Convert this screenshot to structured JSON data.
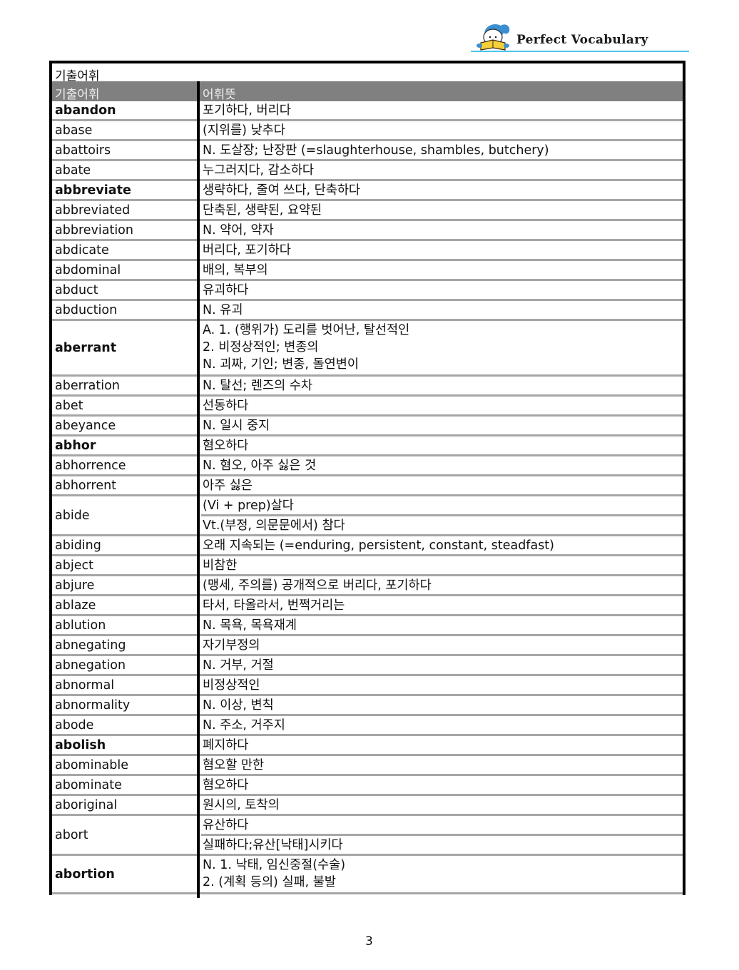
{
  "brand": {
    "name": "Perfect Vocabulary",
    "mascot_icon": "reading-mascot-icon",
    "accent_color": "#4fc3e8"
  },
  "table": {
    "title": "기출어휘",
    "header_color": "#808080",
    "columns": [
      "기출어휘",
      "어휘뜻"
    ],
    "rows": [
      {
        "word": "abandon",
        "bold": true,
        "meanings": [
          [
            "포기하다, 버리다"
          ]
        ]
      },
      {
        "word": "abase",
        "bold": false,
        "meanings": [
          [
            "(지위를)  낮추다"
          ]
        ]
      },
      {
        "word": "abattoirs",
        "bold": false,
        "meanings": [
          [
            "N. 도살장; 난장판  (=slaughterhouse, shambles, butchery)"
          ]
        ]
      },
      {
        "word": "abate",
        "bold": false,
        "meanings": [
          [
            "누그러지다, 감소하다"
          ]
        ]
      },
      {
        "word": "abbreviate",
        "bold": true,
        "meanings": [
          [
            "생략하다, 줄여 쓰다, 단축하다"
          ]
        ]
      },
      {
        "word": "abbreviated",
        "bold": false,
        "meanings": [
          [
            "단축된, 생략된, 요약된"
          ]
        ]
      },
      {
        "word": "abbreviation",
        "bold": false,
        "meanings": [
          [
            "N. 약어, 약자"
          ]
        ]
      },
      {
        "word": "abdicate",
        "bold": false,
        "meanings": [
          [
            "버리다, 포기하다"
          ]
        ]
      },
      {
        "word": "abdominal",
        "bold": false,
        "meanings": [
          [
            "배의, 복부의"
          ]
        ]
      },
      {
        "word": "abduct",
        "bold": false,
        "meanings": [
          [
            "유괴하다"
          ]
        ]
      },
      {
        "word": "abduction",
        "bold": false,
        "meanings": [
          [
            "N. 유괴"
          ]
        ]
      },
      {
        "word": "aberrant",
        "bold": true,
        "meanings": [
          [
            "A. 1. (행위가) 도리를 벗어난, 탈선적인",
            "2. 비정상적인; 변종의",
            "N. 괴짜, 기인; 변종, 돌연변이"
          ]
        ]
      },
      {
        "word": "aberration",
        "bold": false,
        "meanings": [
          [
            "N. 탈선; 렌즈의 수차"
          ]
        ]
      },
      {
        "word": "abet",
        "bold": false,
        "meanings": [
          [
            "선동하다"
          ]
        ]
      },
      {
        "word": "abeyance",
        "bold": false,
        "meanings": [
          [
            "N. 일시 중지"
          ]
        ]
      },
      {
        "word": "abhor",
        "bold": true,
        "meanings": [
          [
            "혐오하다"
          ]
        ]
      },
      {
        "word": "abhorrence",
        "bold": false,
        "meanings": [
          [
            "N. 혐오, 아주 싫은 것"
          ]
        ]
      },
      {
        "word": "abhorrent",
        "bold": false,
        "meanings": [
          [
            "아주 싫은"
          ]
        ]
      },
      {
        "word": "abide",
        "bold": false,
        "meanings": [
          [
            "(Vi + prep)살다"
          ],
          [
            "Vt.(부정, 의문문에서) 참다"
          ]
        ]
      },
      {
        "word": "abiding",
        "bold": false,
        "meanings": [
          [
            "오래 지속되는 (=enduring, persistent, constant, steadfast)"
          ]
        ]
      },
      {
        "word": "abject",
        "bold": false,
        "meanings": [
          [
            "비참한"
          ]
        ]
      },
      {
        "word": "abjure",
        "bold": false,
        "meanings": [
          [
            "(맹세, 주의를) 공개적으로 버리다, 포기하다"
          ]
        ]
      },
      {
        "word": "ablaze",
        "bold": false,
        "meanings": [
          [
            "타서, 타올라서, 번쩍거리는"
          ]
        ]
      },
      {
        "word": "ablution",
        "bold": false,
        "meanings": [
          [
            "N. 목욕, 목욕재계"
          ]
        ]
      },
      {
        "word": "abnegating",
        "bold": false,
        "meanings": [
          [
            "자기부정의"
          ]
        ]
      },
      {
        "word": "abnegation",
        "bold": false,
        "meanings": [
          [
            "N. 거부, 거절"
          ]
        ]
      },
      {
        "word": "abnormal",
        "bold": false,
        "meanings": [
          [
            "비정상적인"
          ]
        ]
      },
      {
        "word": "abnormality",
        "bold": false,
        "meanings": [
          [
            "N. 이상, 변칙"
          ]
        ]
      },
      {
        "word": "abode",
        "bold": false,
        "meanings": [
          [
            "N. 주소, 거주지"
          ]
        ]
      },
      {
        "word": "abolish",
        "bold": true,
        "meanings": [
          [
            "폐지하다"
          ]
        ]
      },
      {
        "word": "abominable",
        "bold": false,
        "meanings": [
          [
            "혐오할 만한"
          ]
        ]
      },
      {
        "word": "abominate",
        "bold": false,
        "meanings": [
          [
            "혐오하다"
          ]
        ]
      },
      {
        "word": "aboriginal",
        "bold": false,
        "meanings": [
          [
            "원시의, 토착의"
          ]
        ]
      },
      {
        "word": "abort",
        "bold": false,
        "meanings": [
          [
            "유산하다"
          ],
          [
            "실패하다;유산[낙태]시키다"
          ]
        ]
      },
      {
        "word": "abortion",
        "bold": true,
        "meanings": [
          [
            "N. 1. 낙태, 임신중절(수술)",
            "2. (계획 등의) 실패, 불발"
          ]
        ]
      }
    ]
  },
  "page": {
    "number": "3"
  }
}
